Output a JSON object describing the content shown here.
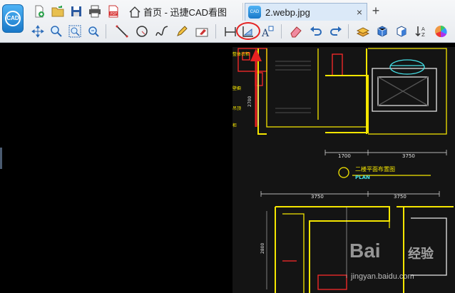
{
  "app": {
    "logo_text": "CAD"
  },
  "tabs": [
    {
      "label": "首页 - 迅捷CAD看图"
    },
    {
      "label": "2.webp.jpg",
      "close": "×"
    }
  ],
  "tab_add": "+",
  "toolbar_row1": [
    "new-file-icon",
    "open-folder-icon",
    "save-icon",
    "print-icon",
    "pdf-icon"
  ],
  "toolbar_row2": [
    "pan-icon",
    "zoom-icon",
    "zoom-window-icon",
    "zoom-previous-icon",
    "line-icon",
    "circle-icon",
    "spline-icon",
    "pencil-icon",
    "erase-text-icon",
    "measure-linear-icon",
    "measure-area-icon",
    "text-icon",
    "eraser-icon",
    "undo-icon",
    "redo-icon",
    "layers-icon",
    "3d-box-icon",
    "3d-view-icon",
    "sort-icon",
    "color-wheel-icon"
  ],
  "drawing": {
    "labels": [
      "二楼平面布置图",
      "PLAN",
      "1700",
      "3750",
      "3750",
      "3750",
      "2700",
      "2800"
    ],
    "left_notes": [
      "整体衣柜",
      "壁橱",
      "吊顶",
      "柜"
    ]
  },
  "watermark": {
    "brand": "Bai",
    "brand2": "经验",
    "url": "jingyan.baidu.com"
  },
  "colors": {
    "highlight": "#e52222",
    "cad_yellow": "#f5e600",
    "cad_white": "#e8e8e8",
    "cad_red": "#ff2a2a",
    "cad_cyan": "#46e1e8"
  }
}
